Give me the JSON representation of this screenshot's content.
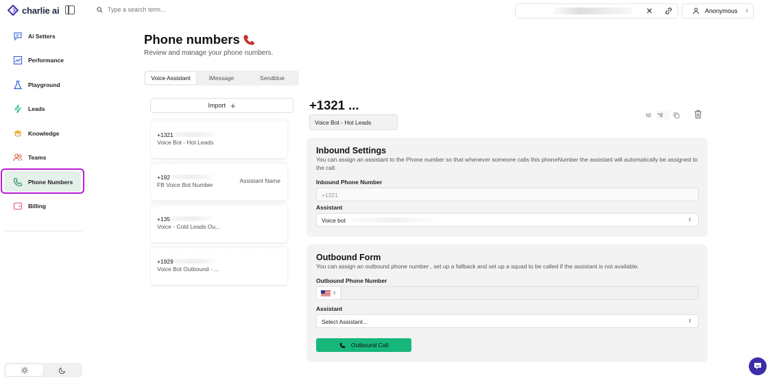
{
  "app": {
    "name": "charlie ai"
  },
  "sidebar": {
    "items": [
      {
        "label": "Ai Setters",
        "icon": "chat-icon"
      },
      {
        "label": "Performance",
        "icon": "chart-icon"
      },
      {
        "label": "Playground",
        "icon": "flask-icon"
      },
      {
        "label": "Leads",
        "icon": "bolt-icon"
      },
      {
        "label": "Knowledge",
        "icon": "graduation-cap-icon"
      },
      {
        "label": "Teams",
        "icon": "users-icon"
      },
      {
        "label": "Phone Numbers",
        "icon": "phone-icon",
        "active": true
      },
      {
        "label": "Billing",
        "icon": "billing-icon"
      }
    ],
    "theme": {
      "selected": "light"
    }
  },
  "topbar": {
    "search_placeholder": "Type a search term...",
    "user_label": "Anonymous"
  },
  "page": {
    "title": "Phone numbers",
    "subtitle": "Review and manage your phone numbers."
  },
  "tabs": [
    {
      "label": "Voice Assistant",
      "selected": true
    },
    {
      "label": "iMessage",
      "selected": false
    },
    {
      "label": "Sendblue",
      "selected": false
    }
  ],
  "list": {
    "import_label": "Import",
    "numbers": [
      {
        "number": "+1321",
        "name": "Voice Bot - Hot Leads",
        "assistant": ""
      },
      {
        "number": "+192",
        "name": "FB Voice Bot Number",
        "assistant": "Assistant Name"
      },
      {
        "number": "+135",
        "name": "Voice - Cold Leads Ou...",
        "assistant": ""
      },
      {
        "number": "+1929",
        "name": "Voice Bot Outbound - ...",
        "assistant": ""
      }
    ]
  },
  "detail": {
    "number": "+1321 ...",
    "name": "Voice Bot - Hot Leads",
    "id_label": "Id:",
    "id_value": "*8",
    "inbound": {
      "title": "Inbound Settings",
      "description": "You can assign an assistant to the Phone number so that whenever someone calls this phoneNumber the assistant will automatically be assigned to the call.",
      "phone_label": "Inbound Phone Number",
      "phone_value": "+1321",
      "assistant_label": "Assistant",
      "assistant_value": "Voice bot"
    },
    "outbound": {
      "title": "Outbound Form",
      "description": "You can assign an outbound phone number , set up a fallback and set up a squad to be called if the assistant is not available.",
      "phone_label": "Outbound Phone Number",
      "assistant_label": "Assistant",
      "assistant_placeholder": "Select Assistant...",
      "call_label": "Outbound Call"
    }
  },
  "colors": {
    "accent": "#17b67a",
    "highlight_ring": "#b51fd1",
    "brand": "#3a2fa8"
  }
}
